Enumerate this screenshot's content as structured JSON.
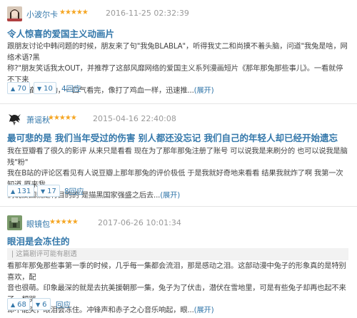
{
  "reviews": [
    {
      "username": "小波尔卡",
      "stars": "★★★★★",
      "time": "2016-11-25 02:32:39",
      "title": "令人惊喜的爱国主义动画片",
      "body_lines": [
        "跟朋友讨论中韩问题的时候，朋友来了句\"我兔BLABLA\"，听得我丈二和尚摸不着头脑，问道\"我兔是啥，网络术语?黑",
        "称?\"朋友笑话我太OUT，并推荐了这部风靡网络的爱国主义系列漫画短片《那年那兔那些事儿》。一看就停不下来",
        "了，兴奋、感动，一口气看完，像打了鸡血一样，迅速推..."
      ],
      "expand": "(展开)",
      "up": "70",
      "down": "10",
      "replies": "4回应"
    },
    {
      "username": "萧谣秋",
      "stars": "★★★★★",
      "time": "2015-04-16 22:40:08",
      "title": "最可悲的是 我们当年受过的伤害 别人都还没忘记 我们自己的年轻人却已经开始遗忘",
      "body_lines": [
        "我在豆瓣看了很久的影评 从来只是看看 现在为了那年那兔注册了账号 可以说我是来刷分的 也可以说我是脑残\"粉\"",
        "我在B站的评论区看见有人说豆瓣上那年那兔的评价极低 于是我就好奇地来看看 结果我就炸了啊 我第一次知道 原来我",
        "们说爱国就是有目的的 是描黑国家强盛之后去..."
      ],
      "expand": "(展开)",
      "up": "131",
      "down": "17",
      "replies": "8回应"
    },
    {
      "username": "眼镜包",
      "stars": "★★★★★",
      "time": "2017-06-26 10:01:34",
      "title": "眼泪是会冻住的",
      "folded": "这篇剧评可能有剧透",
      "body_lines": [
        "看那年那兔那些事第一季的时候，几乎每一集都会流泪，那是感动之泪。这部动漫中兔子的形象真的是特别喜欢，配",
        "音也很萌。印象最深的就是去抗美援朝那一集，兔子为了伏击，潜伏在雪地里，可是有些兔子却再也起不来了，想哭",
        "却不能哭，眼泪会冻住。冲锋声和赤子之心音乐响起，眼..."
      ],
      "expand": "(展开)",
      "up": "68",
      "down": "6",
      "replies": "回应"
    }
  ]
}
